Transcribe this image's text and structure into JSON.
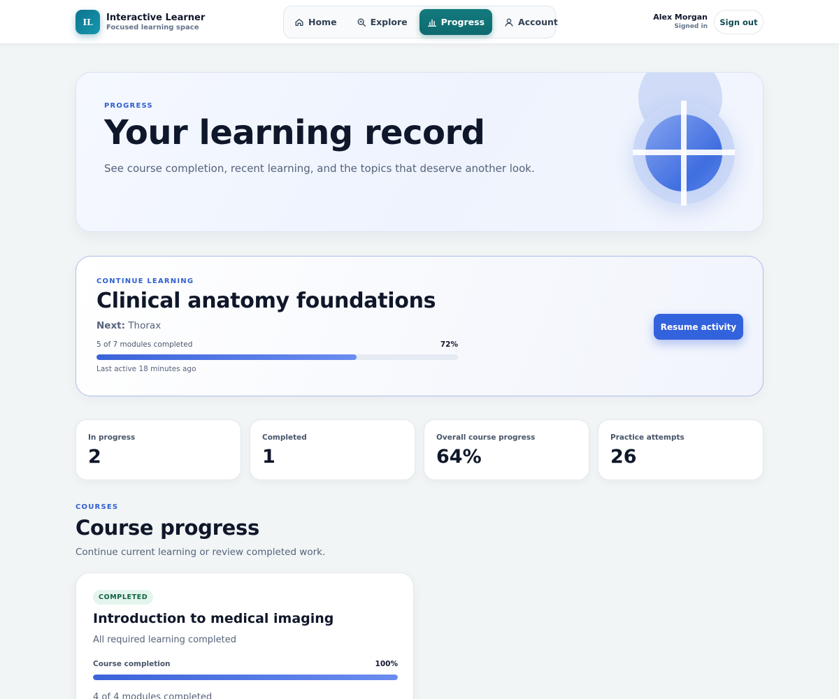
{
  "brand": {
    "logo_text": "IL",
    "name": "Interactive Learner",
    "tagline": "Focused learning space"
  },
  "nav": {
    "items": [
      {
        "label": "Home",
        "icon": "home-icon",
        "active": false
      },
      {
        "label": "Explore",
        "icon": "search-icon",
        "active": false
      },
      {
        "label": "Progress",
        "icon": "bar-chart-icon",
        "active": true
      },
      {
        "label": "Account",
        "icon": "user-icon",
        "active": false
      }
    ]
  },
  "user": {
    "name": "Alex Morgan",
    "status": "Signed in",
    "signout_label": "Sign out"
  },
  "hero": {
    "eyebrow": "PROGRESS",
    "title": "Your learning record",
    "subtitle": "See course completion, recent learning, and the topics that deserve another look."
  },
  "continue": {
    "eyebrow": "CONTINUE LEARNING",
    "title": "Clinical anatomy foundations",
    "next_label": "Next:",
    "next_value": "Thorax",
    "modules_text": "5 of 7 modules completed",
    "percent_text": "72%",
    "progress": 0.72,
    "last_active": "Last active 18 minutes ago",
    "button_label": "Resume activity"
  },
  "stats": [
    {
      "label": "In progress",
      "value": "2"
    },
    {
      "label": "Completed",
      "value": "1"
    },
    {
      "label": "Overall course progress",
      "value": "64%"
    },
    {
      "label": "Practice attempts",
      "value": "26"
    }
  ],
  "courses": {
    "eyebrow": "COURSES",
    "title": "Course progress",
    "subtitle": "Continue current learning or review completed work.",
    "items": [
      {
        "badge": "COMPLETED",
        "title": "Introduction to medical imaging",
        "status": "All required learning completed",
        "completion_label": "Course completion",
        "completion_text": "100%",
        "progress": 1.0,
        "modules_text": "4 of 4 modules completed"
      }
    ]
  },
  "colors": {
    "accent": "#3362dd",
    "nav_active": "#0e6a6e",
    "badge_bg": "#e4f5ee",
    "badge_text": "#12633f"
  }
}
